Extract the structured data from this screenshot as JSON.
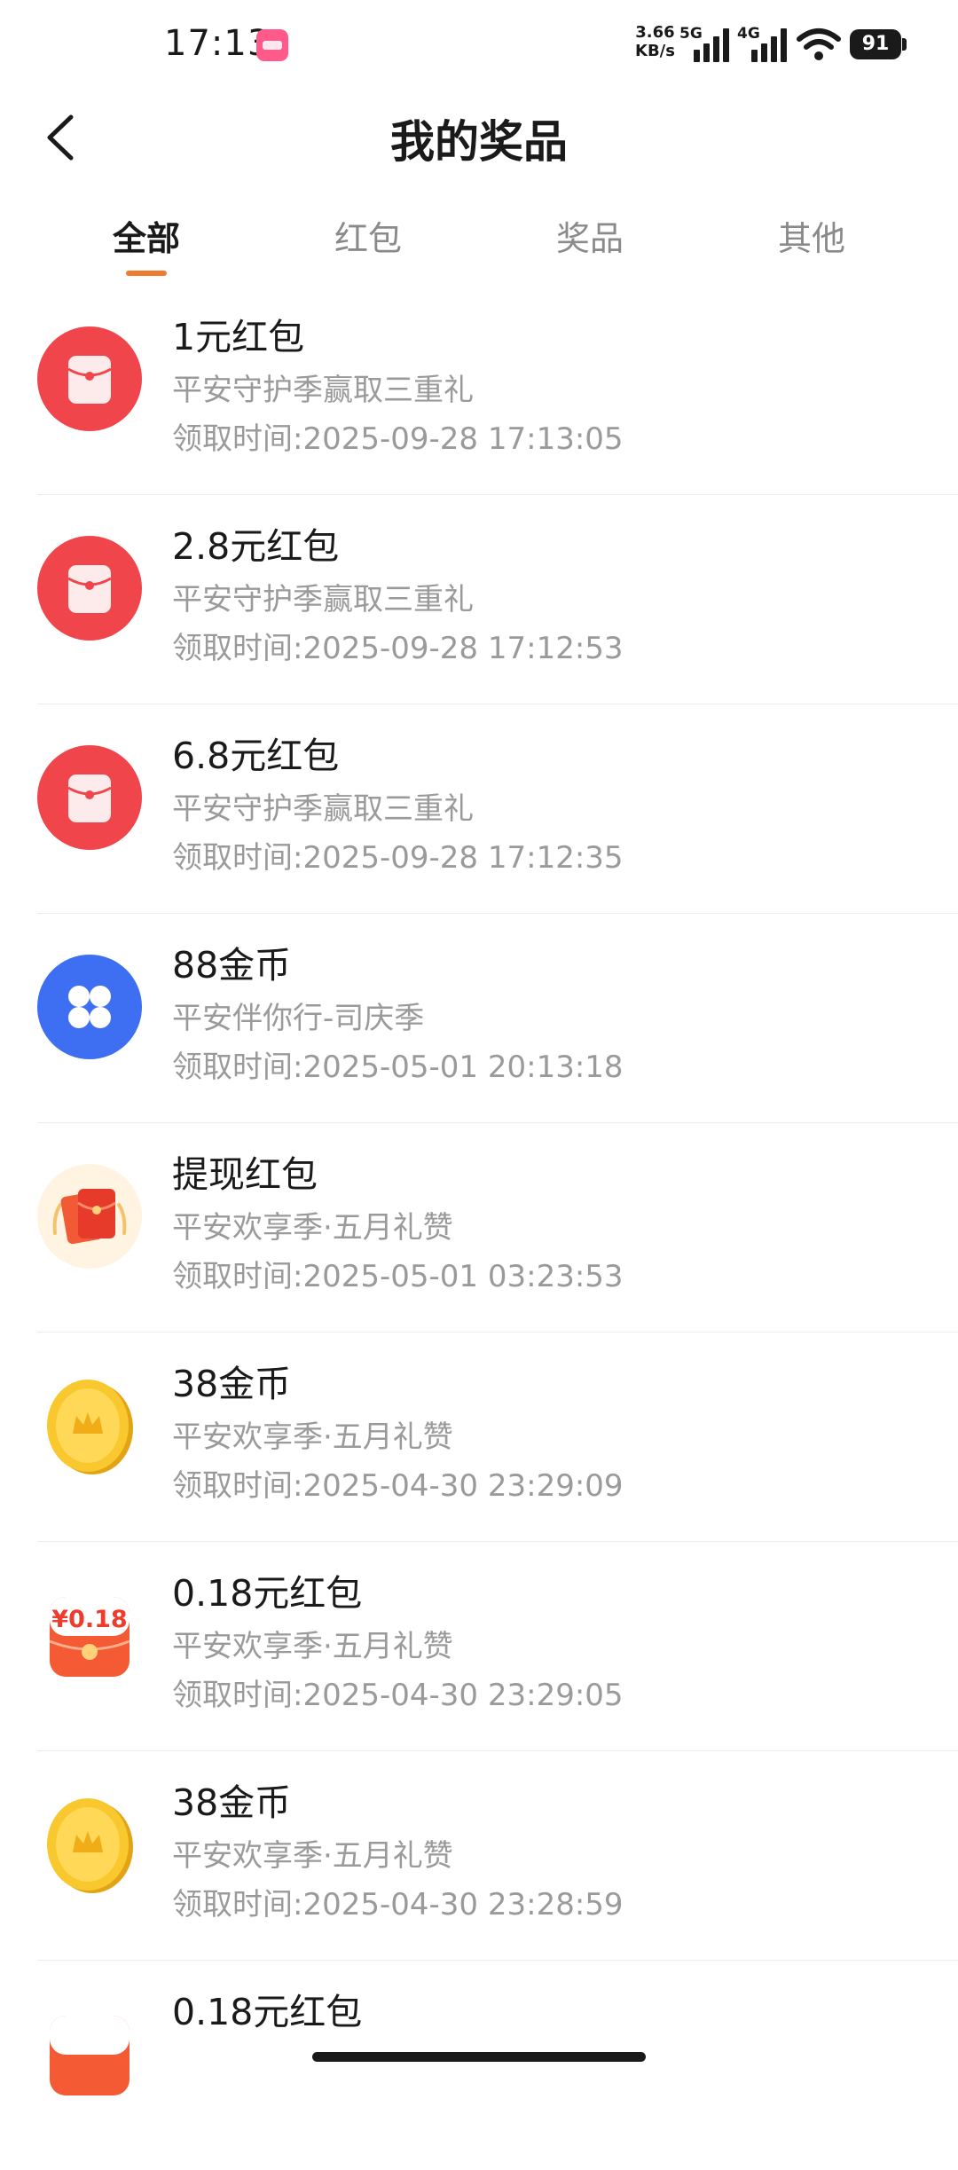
{
  "status_bar": {
    "time": "17:13",
    "speed_value": "3.66",
    "speed_unit": "KB/s",
    "net1": "5G",
    "net2": "4G",
    "battery": "91"
  },
  "header": {
    "title": "我的奖品",
    "back_icon": "chevron-left-icon"
  },
  "tabs": [
    {
      "label": "全部",
      "active": true
    },
    {
      "label": "红包",
      "active": false
    },
    {
      "label": "奖品",
      "active": false
    },
    {
      "label": "其他",
      "active": false
    }
  ],
  "colors": {
    "accent": "#f07b2e",
    "red_packet": "#f0454b",
    "blue_coin": "#3e6ef1",
    "gold": "#f5b91c"
  },
  "prizes": [
    {
      "title": "1元红包",
      "subtitle": "平安守护季赢取三重礼",
      "time": "领取时间:2025-09-28 17:13:05",
      "icon": "red-packet-icon"
    },
    {
      "title": "2.8元红包",
      "subtitle": "平安守护季赢取三重礼",
      "time": "领取时间:2025-09-28 17:12:53",
      "icon": "red-packet-icon"
    },
    {
      "title": "6.8元红包",
      "subtitle": "平安守护季赢取三重礼",
      "time": "领取时间:2025-09-28 17:12:35",
      "icon": "red-packet-icon"
    },
    {
      "title": "88金币",
      "subtitle": "平安伴你行-司庆季",
      "time": "领取时间:2025-05-01 20:13:18",
      "icon": "clover-icon"
    },
    {
      "title": "提现红包",
      "subtitle": "平安欢享季·五月礼赞",
      "time": "领取时间:2025-05-01 03:23:53",
      "icon": "envelope-icon"
    },
    {
      "title": "38金币",
      "subtitle": "平安欢享季·五月礼赞",
      "time": "领取时间:2025-04-30 23:29:09",
      "icon": "gold-coin-icon"
    },
    {
      "title": "0.18元红包",
      "subtitle": "平安欢享季·五月礼赞",
      "time": "领取时间:2025-04-30 23:29:05",
      "icon": "red-envelope-amount-icon",
      "icon_text": "¥0.18"
    },
    {
      "title": "38金币",
      "subtitle": "平安欢享季·五月礼赞",
      "time": "领取时间:2025-04-30 23:28:59",
      "icon": "gold-coin-icon"
    },
    {
      "title": "0.18元红包",
      "subtitle": "",
      "time": "",
      "icon": "red-envelope-amount-icon",
      "icon_text": ""
    }
  ]
}
